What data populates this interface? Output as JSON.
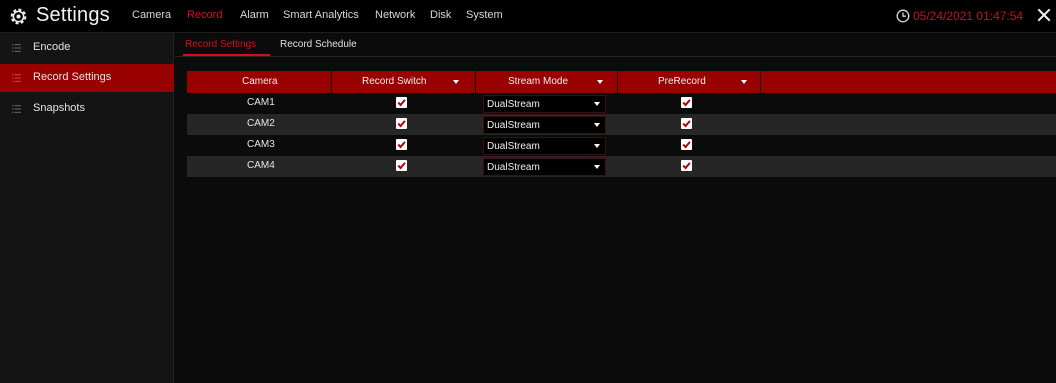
{
  "app": {
    "title": "Settings"
  },
  "menu": [
    {
      "label": "Camera",
      "active": false
    },
    {
      "label": "Record",
      "active": true
    },
    {
      "label": "Alarm",
      "active": false
    },
    {
      "label": "Smart Analytics",
      "active": false
    },
    {
      "label": "Network",
      "active": false
    },
    {
      "label": "Disk",
      "active": false
    },
    {
      "label": "System",
      "active": false
    }
  ],
  "status": {
    "datetime": "05/24/2021 01:47:54"
  },
  "sidebar": {
    "items": [
      {
        "label": "Encode",
        "active": false
      },
      {
        "label": "Record Settings",
        "active": true
      },
      {
        "label": "Snapshots",
        "active": false
      }
    ]
  },
  "tabs": [
    {
      "label": "Record Settings",
      "active": true
    },
    {
      "label": "Record Schedule",
      "active": false
    }
  ],
  "table": {
    "headers": [
      "Camera",
      "Record Switch",
      "Stream Mode",
      "PreRecord"
    ],
    "rows": [
      {
        "camera": "CAM1",
        "record_switch": true,
        "stream_mode": "DualStream",
        "prerecord": true
      },
      {
        "camera": "CAM2",
        "record_switch": true,
        "stream_mode": "DualStream",
        "prerecord": true
      },
      {
        "camera": "CAM3",
        "record_switch": true,
        "stream_mode": "DualStream",
        "prerecord": true
      },
      {
        "camera": "CAM4",
        "record_switch": true,
        "stream_mode": "DualStream",
        "prerecord": true
      }
    ]
  },
  "colors": {
    "accent": "#d0101a",
    "header_fill": "#990000",
    "row_alt": "#262626",
    "background": "#0b0b0b"
  },
  "icons": {
    "app": "gear-icon",
    "clock": "clock-icon",
    "close": "close-icon",
    "sidebar_item": "list-icon",
    "checkbox": "checkmark-icon",
    "dropdown": "caret-down-icon"
  }
}
